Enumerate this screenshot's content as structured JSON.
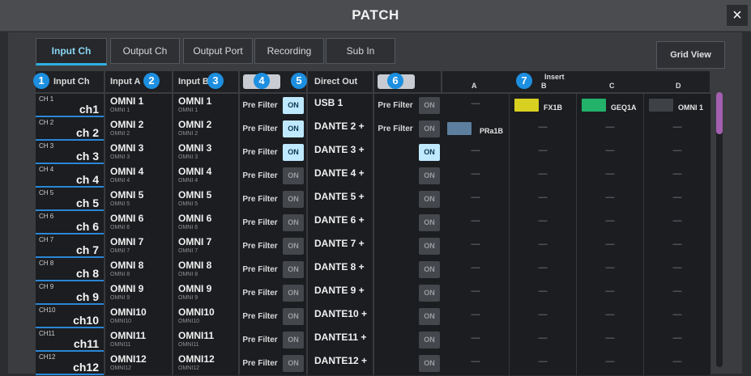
{
  "window": {
    "title": "PATCH",
    "close_label": "×"
  },
  "tabs": [
    {
      "label": "Input Ch",
      "active": true
    },
    {
      "label": "Output Ch",
      "active": false
    },
    {
      "label": "Output Port",
      "active": false
    },
    {
      "label": "Recording",
      "active": false
    },
    {
      "label": "Sub In",
      "active": false
    }
  ],
  "grid_view_label": "Grid View",
  "headers": {
    "input_ch": "Input Ch",
    "input_a": "Input A",
    "input_b": "Input B",
    "direct_out": "Direct Out",
    "insert": "Insert",
    "insert_cols": [
      "A",
      "B",
      "C",
      "D"
    ]
  },
  "badges": [
    "1",
    "2",
    "3",
    "4",
    "5",
    "6",
    "7"
  ],
  "rows": [
    {
      "ch": "CH 1",
      "name": "ch1",
      "a": "OMNI 1",
      "a_sub": "OMNI 1",
      "b": "OMNI 1",
      "b_sub": "OMNI 1",
      "pf": "Pre Filter",
      "on": "ON",
      "on_lit": true,
      "dout": "USB 1",
      "pf2": "Pre Filter",
      "on2": "ON",
      "on2_lit": false,
      "ins": [
        {
          "type": "dash",
          "v": "—"
        },
        {
          "type": "plugin",
          "v": "FX1B",
          "icon": "fx"
        },
        {
          "type": "plugin",
          "v": "GEQ1A",
          "icon": "geq"
        },
        {
          "type": "plugin",
          "v": "OMNI 1",
          "icon": "omni"
        }
      ]
    },
    {
      "ch": "CH 2",
      "name": "ch 2",
      "a": "OMNI 2",
      "a_sub": "OMNI 2",
      "b": "OMNI 2",
      "b_sub": "OMNI 2",
      "pf": "Pre Filter",
      "on": "ON",
      "on_lit": true,
      "dout": "DANTE 2 +",
      "pf2": "Pre Filter",
      "on2": "ON",
      "on2_lit": false,
      "ins": [
        {
          "type": "plugin",
          "v": "PRa1B",
          "icon": "pra"
        },
        {
          "type": "dash",
          "v": "—"
        },
        {
          "type": "dash",
          "v": "—"
        },
        {
          "type": "dash",
          "v": "—"
        }
      ]
    },
    {
      "ch": "CH 3",
      "name": "ch 3",
      "a": "OMNI 3",
      "a_sub": "OMNI 3",
      "b": "OMNI 3",
      "b_sub": "OMNI 3",
      "pf": "Pre Filter",
      "on": "ON",
      "on_lit": true,
      "dout": "DANTE 3 +",
      "pf2": "",
      "on2": "ON",
      "on2_lit": true,
      "ins": [
        {
          "type": "dash",
          "v": "—"
        },
        {
          "type": "dash",
          "v": "—"
        },
        {
          "type": "dash",
          "v": "—"
        },
        {
          "type": "dash",
          "v": "—"
        }
      ]
    },
    {
      "ch": "CH 4",
      "name": "ch 4",
      "a": "OMNI 4",
      "a_sub": "OMNI 4",
      "b": "OMNI 4",
      "b_sub": "OMNI 4",
      "pf": "Pre Filter",
      "on": "ON",
      "on_lit": false,
      "dout": "DANTE 4 +",
      "pf2": "",
      "on2": "ON",
      "on2_lit": false,
      "ins": [
        {
          "type": "dash",
          "v": "—"
        },
        {
          "type": "dash",
          "v": "—"
        },
        {
          "type": "dash",
          "v": "—"
        },
        {
          "type": "dash",
          "v": "—"
        }
      ]
    },
    {
      "ch": "CH 5",
      "name": "ch 5",
      "a": "OMNI 5",
      "a_sub": "OMNI 5",
      "b": "OMNI 5",
      "b_sub": "OMNI 5",
      "pf": "Pre Filter",
      "on": "ON",
      "on_lit": false,
      "dout": "DANTE 5 +",
      "pf2": "",
      "on2": "ON",
      "on2_lit": false,
      "ins": [
        {
          "type": "dash",
          "v": "—"
        },
        {
          "type": "dash",
          "v": "—"
        },
        {
          "type": "dash",
          "v": "—"
        },
        {
          "type": "dash",
          "v": "—"
        }
      ]
    },
    {
      "ch": "CH 6",
      "name": "ch 6",
      "a": "OMNI 6",
      "a_sub": "OMNI 6",
      "b": "OMNI 6",
      "b_sub": "OMNI 6",
      "pf": "Pre Filter",
      "on": "ON",
      "on_lit": false,
      "dout": "DANTE 6 +",
      "pf2": "",
      "on2": "ON",
      "on2_lit": false,
      "ins": [
        {
          "type": "dash",
          "v": "—"
        },
        {
          "type": "dash",
          "v": "—"
        },
        {
          "type": "dash",
          "v": "—"
        },
        {
          "type": "dash",
          "v": "—"
        }
      ]
    },
    {
      "ch": "CH 7",
      "name": "ch 7",
      "a": "OMNI 7",
      "a_sub": "OMNI 7",
      "b": "OMNI 7",
      "b_sub": "OMNI 7",
      "pf": "Pre Filter",
      "on": "ON",
      "on_lit": false,
      "dout": "DANTE 7 +",
      "pf2": "",
      "on2": "ON",
      "on2_lit": false,
      "ins": [
        {
          "type": "dash",
          "v": "—"
        },
        {
          "type": "dash",
          "v": "—"
        },
        {
          "type": "dash",
          "v": "—"
        },
        {
          "type": "dash",
          "v": "—"
        }
      ]
    },
    {
      "ch": "CH 8",
      "name": "ch 8",
      "a": "OMNI 8",
      "a_sub": "OMNI 8",
      "b": "OMNI 8",
      "b_sub": "OMNI 8",
      "pf": "Pre Filter",
      "on": "ON",
      "on_lit": false,
      "dout": "DANTE 8 +",
      "pf2": "",
      "on2": "ON",
      "on2_lit": false,
      "ins": [
        {
          "type": "dash",
          "v": "—"
        },
        {
          "type": "dash",
          "v": "—"
        },
        {
          "type": "dash",
          "v": "—"
        },
        {
          "type": "dash",
          "v": "—"
        }
      ]
    },
    {
      "ch": "CH 9",
      "name": "ch 9",
      "a": "OMNI 9",
      "a_sub": "OMNI 9",
      "b": "OMNI 9",
      "b_sub": "OMNI 9",
      "pf": "Pre Filter",
      "on": "ON",
      "on_lit": false,
      "dout": "DANTE 9 +",
      "pf2": "",
      "on2": "ON",
      "on2_lit": false,
      "ins": [
        {
          "type": "dash",
          "v": "—"
        },
        {
          "type": "dash",
          "v": "—"
        },
        {
          "type": "dash",
          "v": "—"
        },
        {
          "type": "dash",
          "v": "—"
        }
      ]
    },
    {
      "ch": "CH10",
      "name": "ch10",
      "a": "OMNI10",
      "a_sub": "OMNI10",
      "b": "OMNI10",
      "b_sub": "OMNI10",
      "pf": "Pre Filter",
      "on": "ON",
      "on_lit": false,
      "dout": "DANTE10 +",
      "pf2": "",
      "on2": "ON",
      "on2_lit": false,
      "ins": [
        {
          "type": "dash",
          "v": "—"
        },
        {
          "type": "dash",
          "v": "—"
        },
        {
          "type": "dash",
          "v": "—"
        },
        {
          "type": "dash",
          "v": "—"
        }
      ]
    },
    {
      "ch": "CH11",
      "name": "ch11",
      "a": "OMNI11",
      "a_sub": "OMNI11",
      "b": "OMNI11",
      "b_sub": "OMNI11",
      "pf": "Pre Filter",
      "on": "ON",
      "on_lit": false,
      "dout": "DANTE11 +",
      "pf2": "",
      "on2": "ON",
      "on2_lit": false,
      "ins": [
        {
          "type": "dash",
          "v": "—"
        },
        {
          "type": "dash",
          "v": "—"
        },
        {
          "type": "dash",
          "v": "—"
        },
        {
          "type": "dash",
          "v": "—"
        }
      ]
    },
    {
      "ch": "CH12",
      "name": "ch12",
      "a": "OMNI12",
      "a_sub": "OMNI12",
      "b": "OMNI12",
      "b_sub": "OMNI12",
      "pf": "Pre Filter",
      "on": "ON",
      "on_lit": false,
      "dout": "DANTE12 +",
      "pf2": "",
      "on2": "ON",
      "on2_lit": false,
      "ins": [
        {
          "type": "dash",
          "v": "—"
        },
        {
          "type": "dash",
          "v": "—"
        },
        {
          "type": "dash",
          "v": "—"
        },
        {
          "type": "dash",
          "v": "—"
        }
      ]
    }
  ],
  "colors": {
    "accent": "#2fb0e6",
    "on_lit": "#bfe9ff",
    "badge": "#1d8fe0",
    "scroll_thumb": "#a35fb0"
  },
  "icons": {
    "fx": "fx-plugin-icon",
    "geq": "geq-plugin-icon",
    "omni": "omni-plugin-icon",
    "pra": "pra-plugin-icon"
  }
}
